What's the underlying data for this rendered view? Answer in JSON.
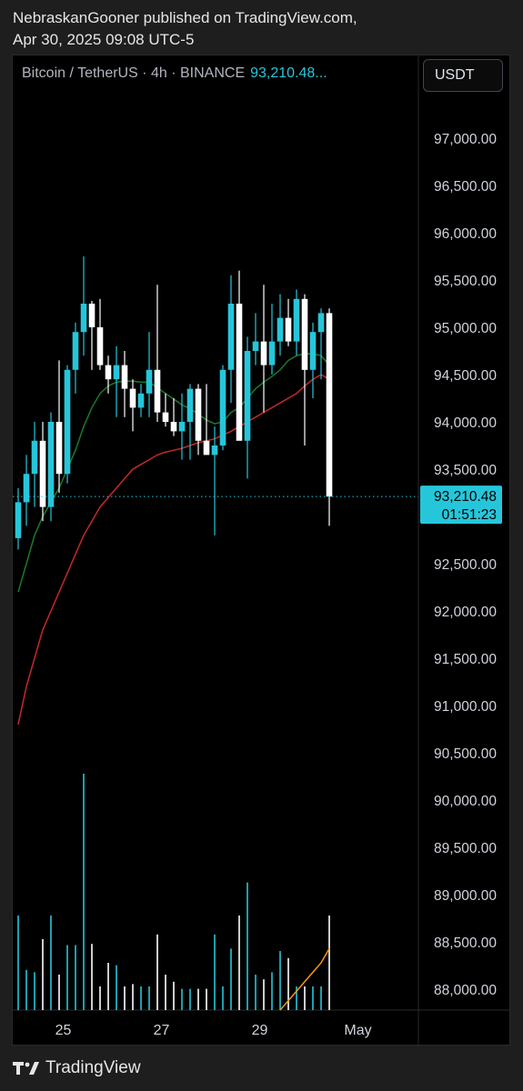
{
  "header": {
    "line1": "NebraskanGooner published on TradingView.com,",
    "line2": "Apr 30, 2025 09:08 UTC-5"
  },
  "symbol": {
    "label": "Bitcoin / TetherUS · 4h · BINANCE",
    "price": "93,210.48..."
  },
  "currency_button": "USDT",
  "price_tag": {
    "price": "93,210.48",
    "countdown": "01:51:23"
  },
  "footer": {
    "brand": "TradingView"
  },
  "colors": {
    "up": "#26c6da",
    "down": "#ffffff",
    "ema_fast": "#1b7a2a",
    "ema_slow": "#c62828",
    "vol_ma": "#ff9800"
  },
  "chart_data": {
    "type": "candlestick",
    "interval": "4h",
    "ylim": [
      87700,
      97600
    ],
    "y_ticks": [
      97000,
      96500,
      96000,
      95500,
      95000,
      94500,
      94000,
      93500,
      92500,
      92000,
      91500,
      91000,
      90500,
      90000,
      89500,
      89000,
      88500,
      88000
    ],
    "y_tick_labels": [
      "97,000.00",
      "96,500.00",
      "96,000.00",
      "95,500.00",
      "95,000.00",
      "94,500.00",
      "94,000.00",
      "93,500.00",
      "92,500.00",
      "92,000.00",
      "91,500.00",
      "91,000.00",
      "90,500.00",
      "90,000.00",
      "89,500.00",
      "89,000.00",
      "88,500.00",
      "88,000.00"
    ],
    "x_ticks": [
      {
        "label": "25",
        "index": 5.5
      },
      {
        "label": "27",
        "index": 17.5
      },
      {
        "label": "29",
        "index": 29.5
      },
      {
        "label": "May",
        "index": 41.5
      }
    ],
    "candles": [
      {
        "o": 92770,
        "h": 93300,
        "l": 92650,
        "c": 93150
      },
      {
        "o": 93150,
        "h": 93650,
        "l": 92900,
        "c": 93450
      },
      {
        "o": 93450,
        "h": 94000,
        "l": 93100,
        "c": 93800
      },
      {
        "o": 93800,
        "h": 94000,
        "l": 92950,
        "c": 93100
      },
      {
        "o": 93100,
        "h": 94100,
        "l": 92950,
        "c": 94000
      },
      {
        "o": 94000,
        "h": 94650,
        "l": 93250,
        "c": 93450
      },
      {
        "o": 93450,
        "h": 94600,
        "l": 93350,
        "c": 94550
      },
      {
        "o": 94550,
        "h": 95050,
        "l": 94300,
        "c": 94950
      },
      {
        "o": 94950,
        "h": 95750,
        "l": 94700,
        "c": 95250
      },
      {
        "o": 95250,
        "h": 95280,
        "l": 94550,
        "c": 95000
      },
      {
        "o": 95000,
        "h": 95300,
        "l": 94550,
        "c": 94600
      },
      {
        "o": 94600,
        "h": 94700,
        "l": 94300,
        "c": 94450
      },
      {
        "o": 94450,
        "h": 94800,
        "l": 94050,
        "c": 94600
      },
      {
        "o": 94600,
        "h": 94750,
        "l": 94050,
        "c": 94350
      },
      {
        "o": 94350,
        "h": 94450,
        "l": 93900,
        "c": 94150
      },
      {
        "o": 94150,
        "h": 94400,
        "l": 94050,
        "c": 94300
      },
      {
        "o": 94300,
        "h": 94950,
        "l": 94050,
        "c": 94550
      },
      {
        "o": 94550,
        "h": 95450,
        "l": 94000,
        "c": 94100
      },
      {
        "o": 94100,
        "h": 94300,
        "l": 93950,
        "c": 94000
      },
      {
        "o": 94000,
        "h": 94250,
        "l": 93850,
        "c": 93900
      },
      {
        "o": 93900,
        "h": 94300,
        "l": 93600,
        "c": 94000
      },
      {
        "o": 94000,
        "h": 94400,
        "l": 93600,
        "c": 94350
      },
      {
        "o": 94350,
        "h": 94400,
        "l": 93650,
        "c": 93800
      },
      {
        "o": 93800,
        "h": 94400,
        "l": 93700,
        "c": 93650
      },
      {
        "o": 93650,
        "h": 93950,
        "l": 92800,
        "c": 93750
      },
      {
        "o": 93750,
        "h": 94600,
        "l": 93700,
        "c": 94550
      },
      {
        "o": 94550,
        "h": 95550,
        "l": 94200,
        "c": 95250
      },
      {
        "o": 95250,
        "h": 95600,
        "l": 93900,
        "c": 93800
      },
      {
        "o": 93800,
        "h": 94900,
        "l": 93400,
        "c": 94750
      },
      {
        "o": 94750,
        "h": 95150,
        "l": 94600,
        "c": 94850
      },
      {
        "o": 94850,
        "h": 95450,
        "l": 94100,
        "c": 94600
      },
      {
        "o": 94600,
        "h": 95250,
        "l": 94500,
        "c": 94850
      },
      {
        "o": 94850,
        "h": 95350,
        "l": 94700,
        "c": 95100
      },
      {
        "o": 95100,
        "h": 95300,
        "l": 94800,
        "c": 94850
      },
      {
        "o": 94850,
        "h": 95400,
        "l": 94700,
        "c": 95300
      },
      {
        "o": 95300,
        "h": 95350,
        "l": 93750,
        "c": 94550
      },
      {
        "o": 94550,
        "h": 95050,
        "l": 94250,
        "c": 94950
      },
      {
        "o": 94950,
        "h": 95200,
        "l": 94450,
        "c": 95150
      },
      {
        "o": 95150,
        "h": 95200,
        "l": 92900,
        "c": 93210
      }
    ],
    "ema_fast": [
      92200,
      92500,
      92800,
      93000,
      93150,
      93300,
      93500,
      93700,
      93950,
      94150,
      94300,
      94380,
      94420,
      94430,
      94430,
      94420,
      94420,
      94360,
      94300,
      94240,
      94180,
      94140,
      94080,
      94020,
      93980,
      94000,
      94100,
      94150,
      94250,
      94350,
      94420,
      94480,
      94550,
      94650,
      94700,
      94720,
      94720,
      94700,
      94600
    ],
    "ema_slow": [
      90800,
      91200,
      91500,
      91800,
      92000,
      92200,
      92400,
      92600,
      92800,
      92950,
      93100,
      93200,
      93300,
      93400,
      93500,
      93550,
      93600,
      93650,
      93680,
      93700,
      93720,
      93750,
      93780,
      93800,
      93820,
      93860,
      93900,
      93950,
      94000,
      94050,
      94100,
      94150,
      94200,
      94250,
      94300,
      94380,
      94450,
      94500,
      94450
    ],
    "volume": [
      0.8,
      0.34,
      0.32,
      0.6,
      0.8,
      0.3,
      0.55,
      0.55,
      2.0,
      0.56,
      0.2,
      0.4,
      0.38,
      0.2,
      0.22,
      0.2,
      0.2,
      0.64,
      0.3,
      0.24,
      0.18,
      0.18,
      0.18,
      0.18,
      0.64,
      0.2,
      0.52,
      0.8,
      1.08,
      0.3,
      0.26,
      0.32,
      0.5,
      0.44,
      0.2,
      0.2,
      0.2,
      0.2,
      0.8
    ],
    "volume_ma": [
      null,
      null,
      null,
      null,
      null,
      null,
      null,
      null,
      null,
      null,
      null,
      null,
      null,
      null,
      null,
      null,
      null,
      null,
      null,
      null,
      null,
      null,
      null,
      null,
      null,
      null,
      null,
      null,
      null,
      null,
      null,
      null,
      0.0,
      0.08,
      0.16,
      0.24,
      0.32,
      0.4,
      0.52
    ]
  }
}
